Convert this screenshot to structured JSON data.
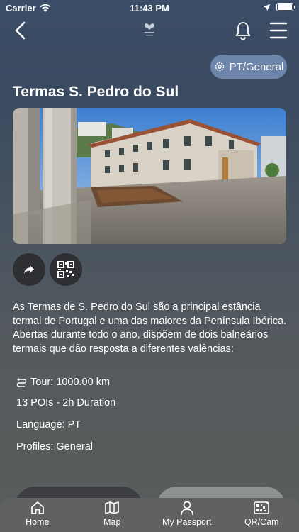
{
  "status_bar": {
    "carrier": "Carrier",
    "time": "11:43 PM"
  },
  "nav": {
    "back_icon": "chevron-left-icon",
    "logo_icon": "heart-logo-icon",
    "bell_icon": "bell-icon",
    "menu_icon": "hamburger-menu-icon"
  },
  "language_button": {
    "label": "PT/General",
    "icon": "gear-icon"
  },
  "title": "Termas S. Pedro do Sul",
  "photo": {
    "subject": "thermal-spa-building"
  },
  "actions": {
    "share_icon": "share-arrow-icon",
    "qr_icon": "qr-code-icon"
  },
  "description": "As Termas de S. Pedro do Sul são a principal estância termal de Portugal e uma das maiores da Península Ibérica. Abertas durante todo o ano, dispõem de dois balneários termais que dão resposta a diferentes valências:",
  "info": {
    "tour": "Tour: 1000.00 km",
    "pois": "13 POIs - 2h Duration",
    "language": "Language: PT",
    "profiles": "Profiles: General"
  },
  "tabbar": {
    "tabs": [
      {
        "label": "Home",
        "icon": "home-icon"
      },
      {
        "label": "Map",
        "icon": "map-icon"
      },
      {
        "label": "My Passport",
        "icon": "person-icon"
      },
      {
        "label": "QR/Cam",
        "icon": "qr-camera-icon"
      }
    ]
  },
  "colors": {
    "pill_accent": "#6e86ab",
    "tabbar_bg": "#5f6162",
    "round_button_bg": "#2d2f33"
  }
}
